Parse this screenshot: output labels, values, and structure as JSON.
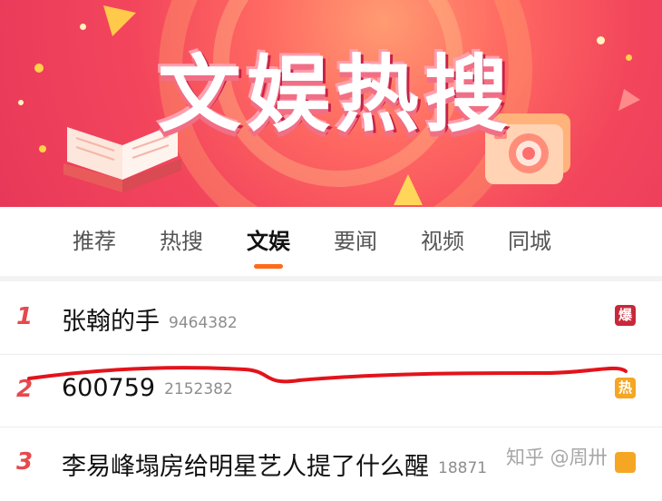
{
  "banner": {
    "title": "文娱热搜"
  },
  "tabs": [
    {
      "label": "推荐"
    },
    {
      "label": "热搜"
    },
    {
      "label": "文娱"
    },
    {
      "label": "要闻"
    },
    {
      "label": "视频"
    },
    {
      "label": "同城"
    }
  ],
  "active_tab": "文娱",
  "list": [
    {
      "rank": "1",
      "title": "张翰的手",
      "count": "9464382",
      "badge": "爆",
      "badge_color": "#c8283a"
    },
    {
      "rank": "2",
      "title": "600759",
      "count": "2152382",
      "badge": "热",
      "badge_color": "#f5a623"
    },
    {
      "rank": "3",
      "title": "李易峰塌房给明星艺人提了什么醒",
      "count": "18871",
      "badge": "",
      "badge_color": "#f5a623"
    }
  ],
  "watermark": "知乎 @周卅",
  "colors": {
    "accent": "#ff6a1a",
    "rank": "#e6494d",
    "banner": "#f3465c"
  }
}
